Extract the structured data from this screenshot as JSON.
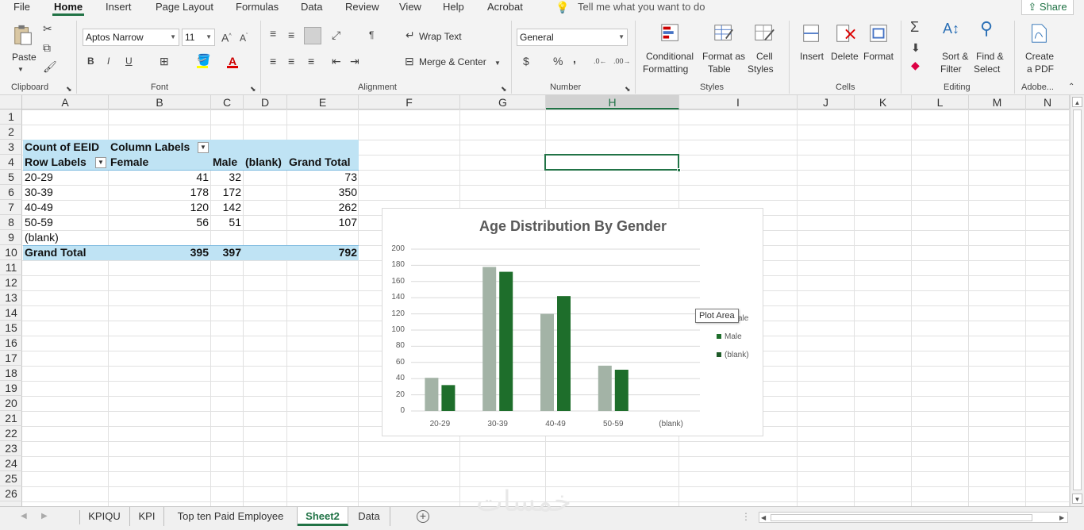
{
  "menu": {
    "tabs": [
      "File",
      "Home",
      "Insert",
      "Page Layout",
      "Formulas",
      "Data",
      "Review",
      "View",
      "Help",
      "Acrobat"
    ],
    "tell_me": "Tell me what you want to do",
    "share": "Share"
  },
  "ribbon": {
    "clipboard": {
      "paste": "Paste",
      "label": "Clipboard"
    },
    "font": {
      "name": "Aptos Narrow",
      "size": "11",
      "bold": "B",
      "italic": "I",
      "underline": "U",
      "label": "Font"
    },
    "alignment": {
      "wrap": "Wrap Text",
      "merge": "Merge & Center",
      "label": "Alignment"
    },
    "number": {
      "format": "General",
      "currency": "$",
      "percent": "%",
      "comma": ",",
      "label": "Number"
    },
    "styles": {
      "conditional": "Conditional",
      "conditional2": "Formatting",
      "format_as": "Format as",
      "format_as2": "Table",
      "cell": "Cell",
      "cell2": "Styles",
      "label": "Styles"
    },
    "cells": {
      "insert": "Insert",
      "delete": "Delete",
      "format": "Format",
      "label": "Cells"
    },
    "editing": {
      "sort": "Sort &",
      "sort2": "Filter",
      "find": "Find &",
      "find2": "Select",
      "label": "Editing"
    },
    "adobe": {
      "create": "Create",
      "create2": "a PDF",
      "label": "Adobe..."
    }
  },
  "columns": [
    "A",
    "B",
    "C",
    "D",
    "E",
    "F",
    "G",
    "H",
    "I",
    "J",
    "K",
    "L",
    "M",
    "N"
  ],
  "rows": [
    "1",
    "2",
    "3",
    "4",
    "5",
    "6",
    "7",
    "8",
    "9",
    "10",
    "11",
    "12",
    "13",
    "14",
    "15",
    "16",
    "17",
    "18",
    "19",
    "20",
    "21",
    "22",
    "23",
    "24",
    "25",
    "26"
  ],
  "pivot": {
    "count_label": "Count of EEID",
    "column_labels": "Column Labels",
    "row_labels": "Row Labels",
    "headers": [
      "Female",
      "Male",
      "(blank)",
      "Grand Total"
    ],
    "rows": [
      {
        "label": "20-29",
        "female": "41",
        "male": "32",
        "total": "73"
      },
      {
        "label": "30-39",
        "female": "178",
        "male": "172",
        "total": "350"
      },
      {
        "label": "40-49",
        "female": "120",
        "male": "142",
        "total": "262"
      },
      {
        "label": "50-59",
        "female": "56",
        "male": "51",
        "total": "107"
      },
      {
        "label": "(blank)",
        "female": "",
        "male": "",
        "total": ""
      }
    ],
    "grand_total": {
      "label": "Grand Total",
      "female": "395",
      "male": "397",
      "total": "792"
    }
  },
  "chart_data": {
    "type": "bar",
    "title": "Age Distribution By Gender",
    "categories": [
      "20-29",
      "30-39",
      "40-49",
      "50-59",
      "(blank)"
    ],
    "series": [
      {
        "name": "Female",
        "values": [
          41,
          178,
          120,
          56,
          0
        ],
        "color": "#a3b3a6"
      },
      {
        "name": "Male",
        "values": [
          32,
          172,
          142,
          51,
          0
        ],
        "color": "#1e6e2b"
      },
      {
        "name": "(blank)",
        "values": [
          0,
          0,
          0,
          0,
          0
        ],
        "color": "#1e5a28"
      }
    ],
    "yticks": [
      "200",
      "180",
      "160",
      "140",
      "120",
      "100",
      "80",
      "60",
      "40",
      "20",
      "0"
    ],
    "ylim": [
      0,
      200
    ],
    "legend_visible": [
      "ale",
      "Male",
      "(blank)"
    ],
    "legend_placement": "right",
    "tooltip": "Plot Area"
  },
  "sheets": [
    "KPIQU",
    "KPI",
    "Top ten Paid Employee",
    "Sheet2",
    "Data"
  ],
  "active_sheet": "Sheet2",
  "selected_column": "H",
  "watermark": "خمسات"
}
